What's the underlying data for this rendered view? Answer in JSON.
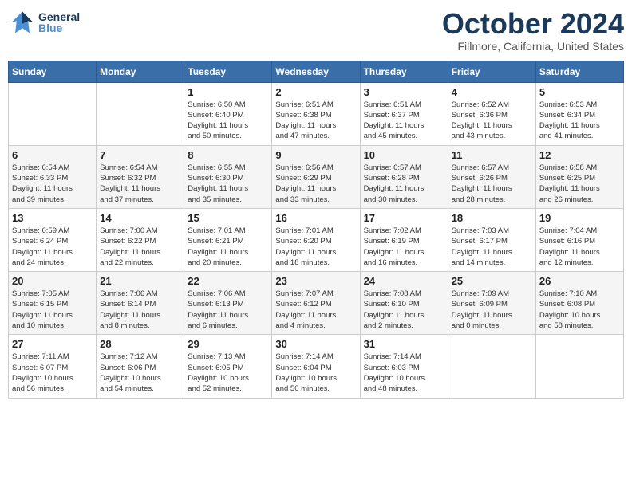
{
  "header": {
    "logo": {
      "general": "General",
      "blue": "Blue"
    },
    "title": "October 2024",
    "location": "Fillmore, California, United States"
  },
  "weekdays": [
    "Sunday",
    "Monday",
    "Tuesday",
    "Wednesday",
    "Thursday",
    "Friday",
    "Saturday"
  ],
  "weeks": [
    [
      {
        "day": "",
        "info": ""
      },
      {
        "day": "",
        "info": ""
      },
      {
        "day": "1",
        "info": "Sunrise: 6:50 AM\nSunset: 6:40 PM\nDaylight: 11 hours\nand 50 minutes."
      },
      {
        "day": "2",
        "info": "Sunrise: 6:51 AM\nSunset: 6:38 PM\nDaylight: 11 hours\nand 47 minutes."
      },
      {
        "day": "3",
        "info": "Sunrise: 6:51 AM\nSunset: 6:37 PM\nDaylight: 11 hours\nand 45 minutes."
      },
      {
        "day": "4",
        "info": "Sunrise: 6:52 AM\nSunset: 6:36 PM\nDaylight: 11 hours\nand 43 minutes."
      },
      {
        "day": "5",
        "info": "Sunrise: 6:53 AM\nSunset: 6:34 PM\nDaylight: 11 hours\nand 41 minutes."
      }
    ],
    [
      {
        "day": "6",
        "info": "Sunrise: 6:54 AM\nSunset: 6:33 PM\nDaylight: 11 hours\nand 39 minutes."
      },
      {
        "day": "7",
        "info": "Sunrise: 6:54 AM\nSunset: 6:32 PM\nDaylight: 11 hours\nand 37 minutes."
      },
      {
        "day": "8",
        "info": "Sunrise: 6:55 AM\nSunset: 6:30 PM\nDaylight: 11 hours\nand 35 minutes."
      },
      {
        "day": "9",
        "info": "Sunrise: 6:56 AM\nSunset: 6:29 PM\nDaylight: 11 hours\nand 33 minutes."
      },
      {
        "day": "10",
        "info": "Sunrise: 6:57 AM\nSunset: 6:28 PM\nDaylight: 11 hours\nand 30 minutes."
      },
      {
        "day": "11",
        "info": "Sunrise: 6:57 AM\nSunset: 6:26 PM\nDaylight: 11 hours\nand 28 minutes."
      },
      {
        "day": "12",
        "info": "Sunrise: 6:58 AM\nSunset: 6:25 PM\nDaylight: 11 hours\nand 26 minutes."
      }
    ],
    [
      {
        "day": "13",
        "info": "Sunrise: 6:59 AM\nSunset: 6:24 PM\nDaylight: 11 hours\nand 24 minutes."
      },
      {
        "day": "14",
        "info": "Sunrise: 7:00 AM\nSunset: 6:22 PM\nDaylight: 11 hours\nand 22 minutes."
      },
      {
        "day": "15",
        "info": "Sunrise: 7:01 AM\nSunset: 6:21 PM\nDaylight: 11 hours\nand 20 minutes."
      },
      {
        "day": "16",
        "info": "Sunrise: 7:01 AM\nSunset: 6:20 PM\nDaylight: 11 hours\nand 18 minutes."
      },
      {
        "day": "17",
        "info": "Sunrise: 7:02 AM\nSunset: 6:19 PM\nDaylight: 11 hours\nand 16 minutes."
      },
      {
        "day": "18",
        "info": "Sunrise: 7:03 AM\nSunset: 6:17 PM\nDaylight: 11 hours\nand 14 minutes."
      },
      {
        "day": "19",
        "info": "Sunrise: 7:04 AM\nSunset: 6:16 PM\nDaylight: 11 hours\nand 12 minutes."
      }
    ],
    [
      {
        "day": "20",
        "info": "Sunrise: 7:05 AM\nSunset: 6:15 PM\nDaylight: 11 hours\nand 10 minutes."
      },
      {
        "day": "21",
        "info": "Sunrise: 7:06 AM\nSunset: 6:14 PM\nDaylight: 11 hours\nand 8 minutes."
      },
      {
        "day": "22",
        "info": "Sunrise: 7:06 AM\nSunset: 6:13 PM\nDaylight: 11 hours\nand 6 minutes."
      },
      {
        "day": "23",
        "info": "Sunrise: 7:07 AM\nSunset: 6:12 PM\nDaylight: 11 hours\nand 4 minutes."
      },
      {
        "day": "24",
        "info": "Sunrise: 7:08 AM\nSunset: 6:10 PM\nDaylight: 11 hours\nand 2 minutes."
      },
      {
        "day": "25",
        "info": "Sunrise: 7:09 AM\nSunset: 6:09 PM\nDaylight: 11 hours\nand 0 minutes."
      },
      {
        "day": "26",
        "info": "Sunrise: 7:10 AM\nSunset: 6:08 PM\nDaylight: 10 hours\nand 58 minutes."
      }
    ],
    [
      {
        "day": "27",
        "info": "Sunrise: 7:11 AM\nSunset: 6:07 PM\nDaylight: 10 hours\nand 56 minutes."
      },
      {
        "day": "28",
        "info": "Sunrise: 7:12 AM\nSunset: 6:06 PM\nDaylight: 10 hours\nand 54 minutes."
      },
      {
        "day": "29",
        "info": "Sunrise: 7:13 AM\nSunset: 6:05 PM\nDaylight: 10 hours\nand 52 minutes."
      },
      {
        "day": "30",
        "info": "Sunrise: 7:14 AM\nSunset: 6:04 PM\nDaylight: 10 hours\nand 50 minutes."
      },
      {
        "day": "31",
        "info": "Sunrise: 7:14 AM\nSunset: 6:03 PM\nDaylight: 10 hours\nand 48 minutes."
      },
      {
        "day": "",
        "info": ""
      },
      {
        "day": "",
        "info": ""
      }
    ]
  ]
}
